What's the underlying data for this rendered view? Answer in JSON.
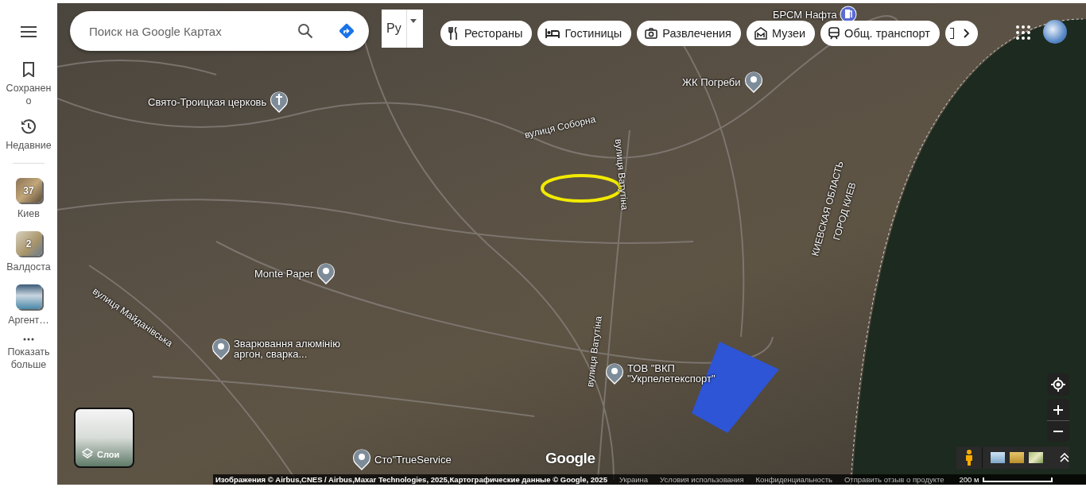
{
  "sidebar": {
    "items": [
      {
        "kind": "saved",
        "label": "Сохранено"
      },
      {
        "kind": "recent",
        "label": "Недавние"
      }
    ],
    "places": [
      {
        "label": "Киев",
        "count": "37"
      },
      {
        "label": "Валдоста",
        "count": "2"
      },
      {
        "label": "Аргент…"
      }
    ],
    "more": {
      "label": "Показать больше"
    }
  },
  "search": {
    "placeholder": "Поиск на Google Картах"
  },
  "language": {
    "label": "Ру"
  },
  "chips": [
    {
      "kind": "restaurant",
      "label": "Рестораны"
    },
    {
      "kind": "hotel",
      "label": "Гостиницы"
    },
    {
      "kind": "camera",
      "label": "Развлечения"
    },
    {
      "kind": "museum",
      "label": "Музеи"
    },
    {
      "kind": "transit",
      "label": "Общ. транспорт"
    }
  ],
  "pins": [
    {
      "kind": "fuel",
      "label": "БРСМ Нафта"
    },
    {
      "kind": "place",
      "label": "ЖК Погреби"
    },
    {
      "kind": "church",
      "label": "Свято-Троицкая церковь"
    },
    {
      "kind": "place",
      "label": "Monte Paper"
    },
    {
      "kind": "place",
      "label": "Зварювання алюмінію аргон, сварка..."
    },
    {
      "kind": "place",
      "label": "ТОВ \"ВКП \"Укрпелетекспорт\""
    },
    {
      "kind": "place",
      "label": "Сто\"TrueService"
    }
  ],
  "streets": [
    {
      "label": "вулиця Соборна"
    },
    {
      "label": "вулиця Ватутіна"
    },
    {
      "label": "вулиця Ватутіна"
    },
    {
      "label": "вулиця Майданівська"
    },
    {
      "label": "КИЕВСКАЯ ОБЛАСТЬ"
    },
    {
      "label": "ГОРОД КИЕВ"
    }
  ],
  "layers": {
    "label": "Слои"
  },
  "logo": "Google",
  "footer": {
    "attribution": "Изображения © Airbus,CNES / Airbus,Maxar Technologies, 2025,Картографические данные © Google, 2025",
    "links": [
      "Украина",
      "Условия использования",
      "Конфиденциальность",
      "Отправить отзыв о продукте"
    ],
    "scale": "200 м"
  }
}
